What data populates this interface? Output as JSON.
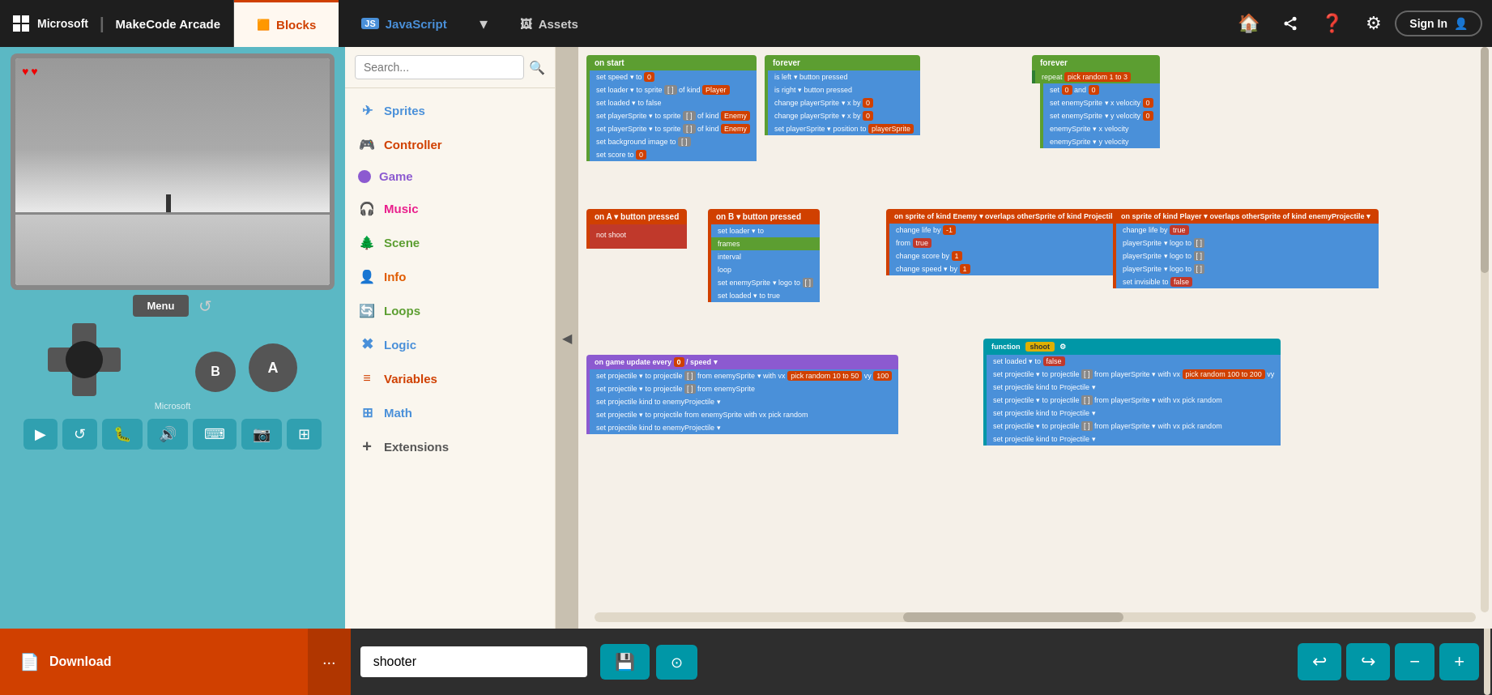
{
  "nav": {
    "brand": "Microsoft",
    "separator": "|",
    "title": "MakeCode Arcade",
    "tabs": [
      {
        "id": "blocks",
        "label": "Blocks",
        "icon": "🟧",
        "active": true
      },
      {
        "id": "javascript",
        "label": "JavaScript",
        "icon": "JS",
        "active": false
      },
      {
        "id": "dropdown",
        "label": "▾",
        "active": false
      },
      {
        "id": "assets",
        "label": "Assets",
        "icon": "🖼",
        "active": false
      }
    ],
    "icons": [
      "🏠",
      "🔗",
      "❓",
      "⚙"
    ],
    "sign_in": "Sign In"
  },
  "blocks_panel": {
    "search_placeholder": "Search...",
    "categories": [
      {
        "id": "sprites",
        "label": "Sprites",
        "color": "#4a90d9",
        "icon": "✈"
      },
      {
        "id": "controller",
        "label": "Controller",
        "color": "#d04000",
        "icon": "🎮"
      },
      {
        "id": "game",
        "label": "Game",
        "color": "#8c5ad0",
        "icon": "⬤"
      },
      {
        "id": "music",
        "label": "Music",
        "color": "#e91e8c",
        "icon": "🎧"
      },
      {
        "id": "scene",
        "label": "Scene",
        "color": "#5c9e31",
        "icon": "🌲"
      },
      {
        "id": "info",
        "label": "Info",
        "color": "#e05c00",
        "icon": "👤"
      },
      {
        "id": "loops",
        "label": "Loops",
        "color": "#5c9e31",
        "icon": "🔄"
      },
      {
        "id": "logic",
        "label": "Logic",
        "color": "#4a90d9",
        "icon": "✖"
      },
      {
        "id": "variables",
        "label": "Variables",
        "color": "#d04000",
        "icon": "≡"
      },
      {
        "id": "math",
        "label": "Math",
        "color": "#4a90d9",
        "icon": "⊞"
      },
      {
        "id": "extensions",
        "label": "Extensions",
        "color": "#555",
        "icon": "+"
      }
    ]
  },
  "simulator": {
    "menu_label": "Menu",
    "refresh_icon": "↺",
    "ms_brand": "Microsoft",
    "toolbar_icons": [
      "▶",
      "↺",
      "👤",
      "🔊",
      "⌨",
      "📷",
      "⊞"
    ]
  },
  "bottom_bar": {
    "download_label": "Download",
    "download_icon": "📄",
    "more_icon": "···",
    "project_name": "shooter",
    "save_icon": "💾",
    "github_icon": "🐙",
    "undo_icon": "↩",
    "redo_icon": "↪",
    "zoom_out_icon": "−",
    "zoom_in_icon": "+"
  }
}
